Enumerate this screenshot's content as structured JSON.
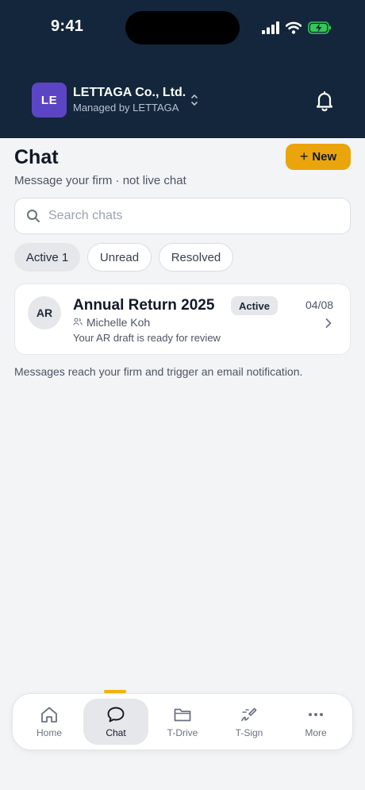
{
  "status_bar": {
    "time": "9:41",
    "icons": [
      "signal-icon",
      "wifi-icon",
      "battery-charging-icon"
    ]
  },
  "header": {
    "org_initials": "LE",
    "org_name": "LETTAGA Co., Ltd.",
    "org_subtitle": "Managed by LETTAGA",
    "icons": [
      "switch-org-icon",
      "bell-icon"
    ]
  },
  "page": {
    "title": "Chat",
    "new_button_plus": "+",
    "new_button_label": "New",
    "subtitle": "Message your firm · not live chat"
  },
  "search": {
    "placeholder": "Search chats",
    "value": ""
  },
  "filters": [
    {
      "label": "Active 1",
      "selected": true
    },
    {
      "label": "Unread",
      "selected": false
    },
    {
      "label": "Resolved",
      "selected": false
    }
  ],
  "chats": [
    {
      "initials": "AR",
      "title": "Annual Return 2025",
      "status": "Active",
      "date": "04/08",
      "participant": "Michelle Koh",
      "preview": "Your AR draft is ready for review"
    }
  ],
  "footnote": "Messages reach your firm and trigger an email notification.",
  "tabbar": {
    "tabs": [
      {
        "label": "Home",
        "icon": "home-icon",
        "selected": false
      },
      {
        "label": "Chat",
        "icon": "chat-bubble-icon",
        "selected": true
      },
      {
        "label": "T-Drive",
        "icon": "folder-icon",
        "selected": false
      },
      {
        "label": "T-Sign",
        "icon": "signature-pen-icon",
        "selected": false
      },
      {
        "label": "More",
        "icon": "more-dots-icon",
        "selected": false
      }
    ]
  },
  "colors": {
    "header_bg": "#13263b",
    "org_avatar_bg": "#5b45c4",
    "accent": "#eaa50c",
    "battery_green": "#34c759",
    "page_bg": "#f3f4f6"
  }
}
